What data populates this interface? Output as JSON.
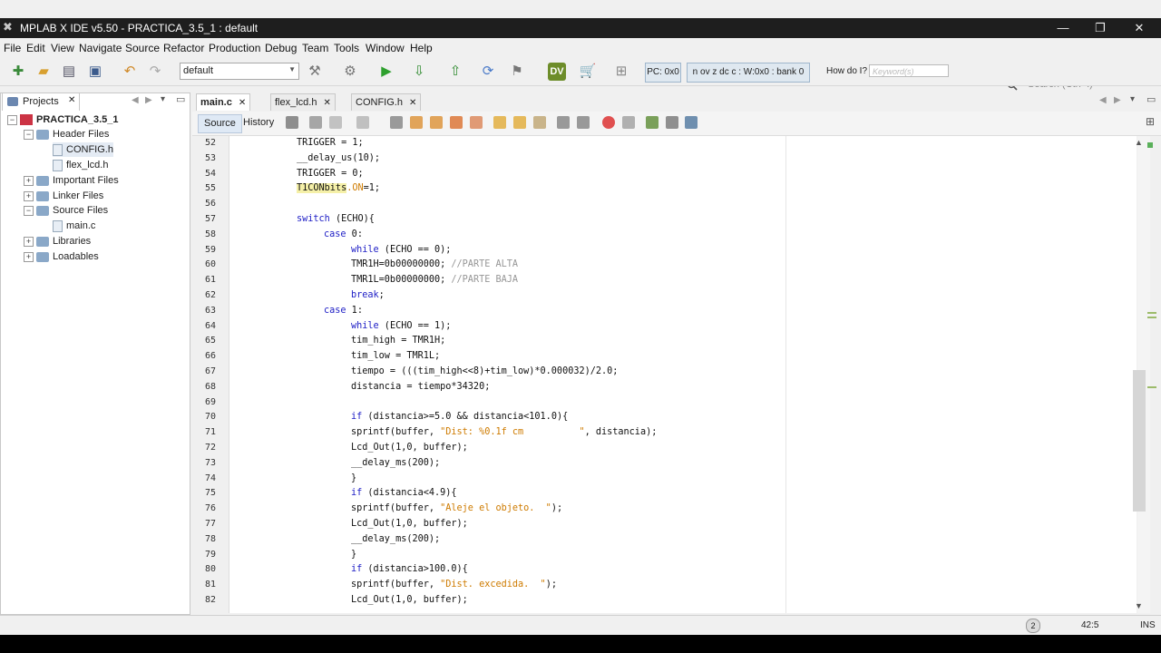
{
  "window": {
    "title": "MPLAB X IDE v5.50 - PRACTICA_3.5_1 : default",
    "icon": "mplab-x-icon",
    "minimize": "—",
    "maximize": "❐",
    "close": "✕"
  },
  "menu": {
    "items": [
      "File",
      "Edit",
      "View",
      "Navigate",
      "Source",
      "Refactor",
      "Production",
      "Debug",
      "Team",
      "Tools",
      "Window",
      "Help"
    ],
    "search_placeholder": "Search (Ctrl+I)"
  },
  "toolbar": {
    "config": "default",
    "pc": "PC: 0x0",
    "status": "n ov z dc c  : W:0x0 : bank 0",
    "how_do_i": "How do I?",
    "keyword_placeholder": "Keyword(s)"
  },
  "projects": {
    "tab_label": "Projects",
    "tab_close": "✕",
    "root": "PRACTICA_3.5_1",
    "header_files": "Header Files",
    "header_children": [
      "CONFIG.h",
      "flex_lcd.h"
    ],
    "important_files": "Important Files",
    "linker_files": "Linker Files",
    "source_files": "Source Files",
    "source_children": [
      "main.c"
    ],
    "libraries": "Libraries",
    "loadables": "Loadables"
  },
  "editor": {
    "tabs": [
      {
        "label": "main.c",
        "close": "✕"
      },
      {
        "label": "flex_lcd.h",
        "close": "✕"
      },
      {
        "label": "CONFIG.h",
        "close": "✕"
      }
    ],
    "source_tab": "Source",
    "history_tab": "History",
    "line_numbers": [
      "52",
      "53",
      "54",
      "55",
      "56",
      "57",
      "58",
      "59",
      "60",
      "61",
      "62",
      "63",
      "64",
      "65",
      "66",
      "67",
      "68",
      "69",
      "70",
      "71",
      "72",
      "73",
      "74",
      "75",
      "76",
      "77",
      "78",
      "79",
      "80",
      "81",
      "82"
    ],
    "lines": [
      {
        "t": "TRIGGER = 1;"
      },
      {
        "t": "__delay_us(10);"
      },
      {
        "t": "TRIGGER = 0;"
      },
      {
        "a": "T1CONbits",
        "b": ".ON",
        "c": "=1;"
      },
      {
        "t": ""
      },
      {
        "t": "switch (ECHO){"
      },
      {
        "t": "case 0:"
      },
      {
        "t": "while (ECHO == 0);"
      },
      {
        "a": "TMR1H=0b00000000; ",
        "b": "//PARTE ALTA"
      },
      {
        "a": "TMR1L=0b00000000; ",
        "b": "//PARTE BAJA"
      },
      {
        "t": "break;"
      },
      {
        "t": "case 1:"
      },
      {
        "t": "while (ECHO == 1);"
      },
      {
        "t": "tim_high = TMR1H;"
      },
      {
        "t": "tim_low = TMR1L;"
      },
      {
        "t": "tiempo = (((tim_high<<8)+tim_low)*0.000032)/2.0;"
      },
      {
        "t": "distancia = tiempo*34320;"
      },
      {
        "t": ""
      },
      {
        "t": "if (distancia>=5.0 && distancia<101.0){"
      },
      {
        "a": "sprintf(buffer, ",
        "b": "\"Dist: %0.1f cm          \"",
        "c": ", distancia);"
      },
      {
        "t": "Lcd_Out(1,0, buffer);"
      },
      {
        "t": "__delay_ms(200);"
      },
      {
        "t": "}"
      },
      {
        "t": "if (distancia<4.9){"
      },
      {
        "a": "sprintf(buffer, ",
        "b": "\"Aleje el objeto.  \"",
        "c": ");"
      },
      {
        "t": "Lcd_Out(1,0, buffer);"
      },
      {
        "t": "__delay_ms(200);"
      },
      {
        "t": "}"
      },
      {
        "t": "if (distancia>100.0){"
      },
      {
        "a": "sprintf(buffer, ",
        "b": "\"Dist. excedida.  \"",
        "c": ");"
      },
      {
        "t": "Lcd_Out(1,0, buffer);"
      }
    ]
  },
  "statusbar": {
    "notifications": "2",
    "position": "42:5",
    "mode": "INS"
  }
}
